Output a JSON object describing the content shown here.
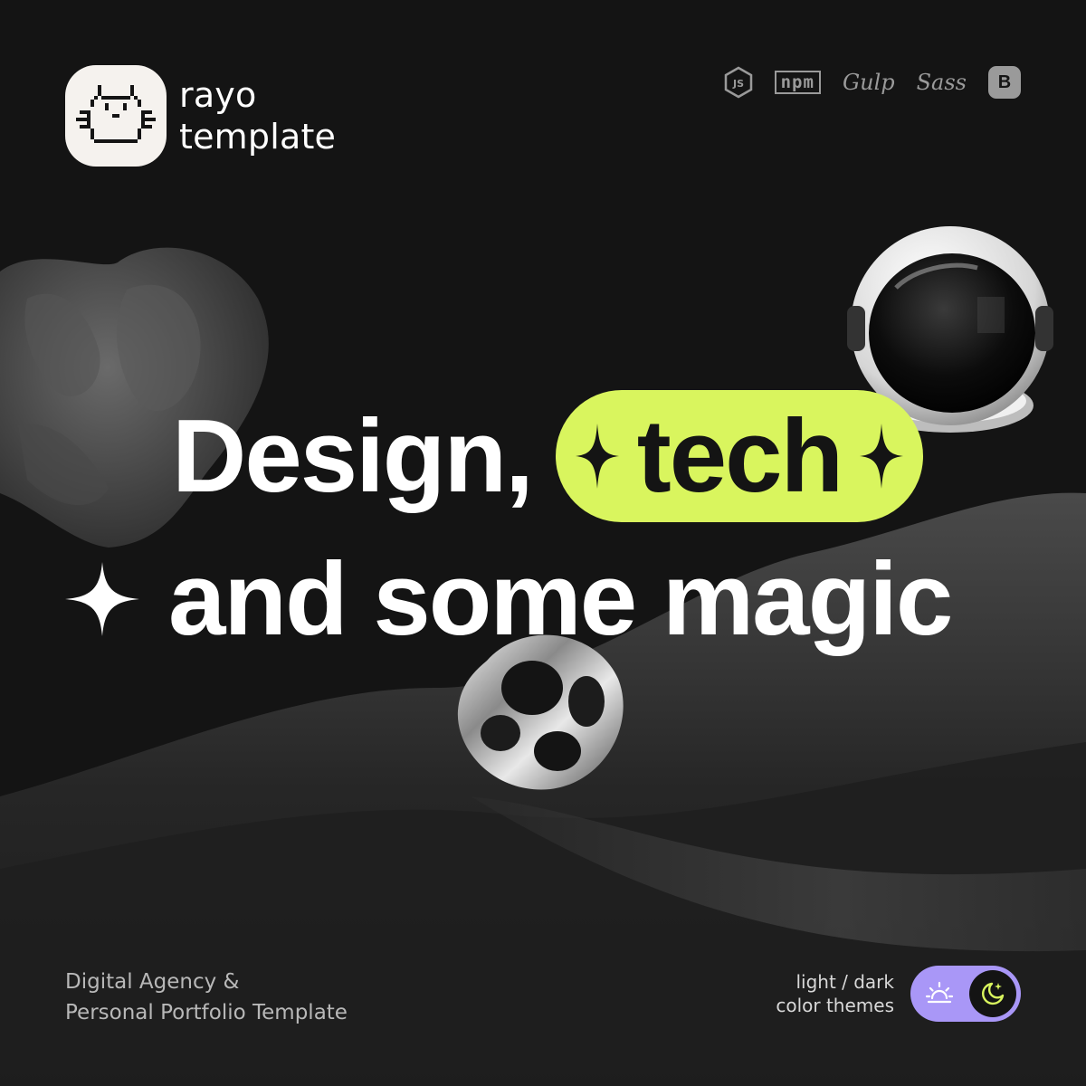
{
  "brand": {
    "line1": "rayo",
    "line2": "template",
    "logo_icon": "pixel-cat-logo",
    "logo_bg": "#f5f2ee"
  },
  "tech_stack": {
    "js_icon": "nodejs-icon",
    "npm_label": "npm",
    "gulp_label": "Gulp",
    "sass_label": "Sass",
    "bootstrap_label": "B"
  },
  "headline": {
    "word1": "Design,",
    "highlight": "tech",
    "line2": "and some magic"
  },
  "footer": {
    "tagline_line1": "Digital Agency &",
    "tagline_line2": "Personal Portfolio Template",
    "themes_line1": "light / dark",
    "themes_line2": "color themes"
  },
  "colors": {
    "background": "#141414",
    "accent_lime": "#d9f55e",
    "accent_lavender": "#a997f7",
    "text": "#ffffff",
    "muted": "#9a9a9a"
  },
  "icons": {
    "sparkle": "sparkle-icon",
    "sun": "sunrise-icon",
    "moon": "moon-icon"
  }
}
